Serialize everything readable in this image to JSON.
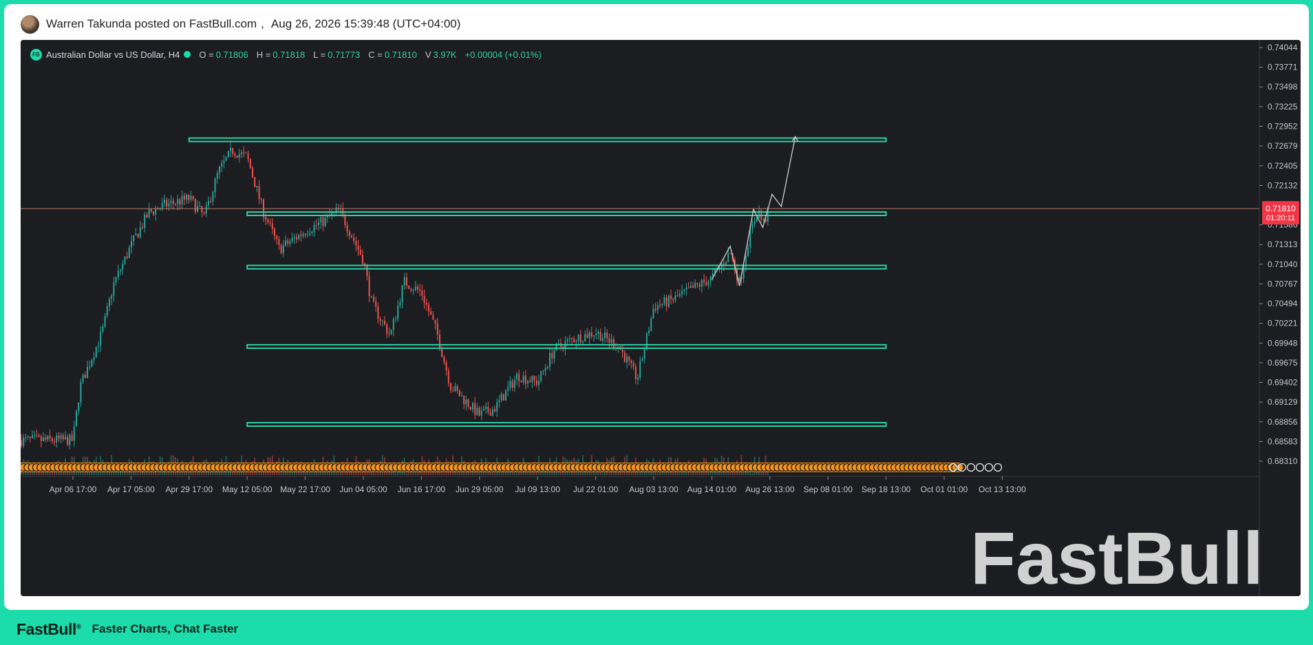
{
  "post": {
    "author_line": "Warren Takunda posted on FastBull.com",
    "separator": ",",
    "timestamp": "Aug 26, 2026 15:39:48 (UTC+04:00)"
  },
  "legend": {
    "badge": "FB",
    "symbol_title": "Australian Dollar vs US Dollar, H4",
    "open_label": "O =",
    "open_value": "0.71806",
    "high_label": "H =",
    "high_value": "0.71818",
    "low_label": "L =",
    "low_value": "0.71773",
    "close_label": "C =",
    "close_value": "0.71810",
    "volume_label": "V",
    "volume_value": "3.97K",
    "change": "+0.00004 (+0.01%)"
  },
  "watermark": "FastBull",
  "footer": {
    "brand": "FastBull",
    "brand_mark": "®",
    "tagline": "Faster Charts, Chat Faster"
  },
  "colors": {
    "up": "#26a69a",
    "down": "#ef5350",
    "zone": "#2ed3a8",
    "price_tag": "#f23645",
    "background": "#1c1d21",
    "brand": "#1ddcab",
    "events": "#f7931a",
    "projection": "#d0d0d0"
  },
  "chart_data": {
    "type": "candlestick",
    "symbol": "Australian Dollar vs US Dollar",
    "timeframe": "H4",
    "y_axis": {
      "range": [
        0.681,
        0.741
      ],
      "ticks": [
        "0.74044",
        "0.73771",
        "0.73498",
        "0.73225",
        "0.72952",
        "0.72679",
        "0.72405",
        "0.72132",
        "0.71586",
        "0.71313",
        "0.71040",
        "0.70767",
        "0.70494",
        "0.70221",
        "0.69948",
        "0.69675",
        "0.69402",
        "0.69129",
        "0.68856",
        "0.68583",
        "0.68310"
      ]
    },
    "x_axis": {
      "ticks": [
        "Apr 06 17:00",
        "Apr 17 05:00",
        "Apr 29 17:00",
        "May 12 05:00",
        "May 22 17:00",
        "Jun 04 05:00",
        "Jun 16 17:00",
        "Jun 29 05:00",
        "Jul 09 13:00",
        "Jul 22 01:00",
        "Aug 03 13:00",
        "Aug 14 01:00",
        "Aug 26 13:00",
        "Sep 08 01:00",
        "Sep 18 13:00",
        "Oct 01 01:00",
        "Oct 13 13:00"
      ]
    },
    "current_price": {
      "value": "0.71810",
      "countdown": "01:20:11"
    },
    "price_path": [
      [
        "Apr 06 17:00",
        0.686
      ],
      [
        "Apr 08",
        0.6935
      ],
      [
        "Apr 12",
        0.701
      ],
      [
        "Apr 14",
        0.7075
      ],
      [
        "Apr 17 05:00",
        0.713
      ],
      [
        "Apr 21",
        0.7175
      ],
      [
        "Apr 24",
        0.7185
      ],
      [
        "Apr 29 17:00",
        0.7195
      ],
      [
        "May 03",
        0.717
      ],
      [
        "May 06",
        0.7232
      ],
      [
        "May 09",
        0.7262
      ],
      [
        "May 12 05:00",
        0.7252
      ],
      [
        "May 15",
        0.718
      ],
      [
        "May 18",
        0.7125
      ],
      [
        "May 22 17:00",
        0.715
      ],
      [
        "May 27",
        0.7165
      ],
      [
        "May 30",
        0.718
      ],
      [
        "Jun 04 05:00",
        0.711
      ],
      [
        "Jun 06",
        0.705
      ],
      [
        "Jun 10",
        0.7005
      ],
      [
        "Jun 13",
        0.708
      ],
      [
        "Jun 16 17:00",
        0.7065
      ],
      [
        "Jun 20",
        0.701
      ],
      [
        "Jun 23",
        0.6935
      ],
      [
        "Jun 29 05:00",
        0.6895
      ],
      [
        "Jul 02",
        0.6905
      ],
      [
        "Jul 06",
        0.695
      ],
      [
        "Jul 09 13:00",
        0.694
      ],
      [
        "Jul 13",
        0.6985
      ],
      [
        "Jul 17",
        0.7
      ],
      [
        "Jul 22 01:00",
        0.701
      ],
      [
        "Jul 27",
        0.699
      ],
      [
        "Jul 31",
        0.6945
      ],
      [
        "Aug 03 13:00",
        0.7045
      ],
      [
        "Aug 07",
        0.7055
      ],
      [
        "Aug 11",
        0.7072
      ],
      [
        "Aug 14 01:00",
        0.7085
      ],
      [
        "Aug 18",
        0.712
      ],
      [
        "Aug 20",
        0.7078
      ],
      [
        "Aug 22",
        0.714
      ],
      [
        "Aug 24",
        0.718
      ],
      [
        "Aug 25",
        0.716
      ],
      [
        "Aug 26 13:00",
        0.7181
      ]
    ],
    "horizontal_zones": [
      {
        "price": 0.72765,
        "from": "Apr 29 17:00",
        "to": "Sep 18 13:00"
      },
      {
        "price": 0.7174,
        "from": "May 12 05:00",
        "to": "Sep 18 13:00"
      },
      {
        "price": 0.71,
        "from": "May 12 05:00",
        "to": "Sep 18 13:00"
      },
      {
        "price": 0.699,
        "from": "May 12 05:00",
        "to": "Sep 18 13:00"
      },
      {
        "price": 0.6882,
        "from": "May 12 05:00",
        "to": "Sep 18 13:00"
      }
    ],
    "projection_path": [
      [
        "Aug 14 01:00",
        0.7083
      ],
      [
        "Aug 18",
        0.7129
      ],
      [
        "Aug 20",
        0.7074
      ],
      [
        "Aug 23",
        0.718
      ],
      [
        "Aug 25",
        0.7155
      ],
      [
        "Aug 27",
        0.7201
      ],
      [
        "Aug 29",
        0.7184
      ],
      [
        "Sep 01",
        0.7281
      ]
    ],
    "legend_placement": "top-left",
    "grid": false
  }
}
